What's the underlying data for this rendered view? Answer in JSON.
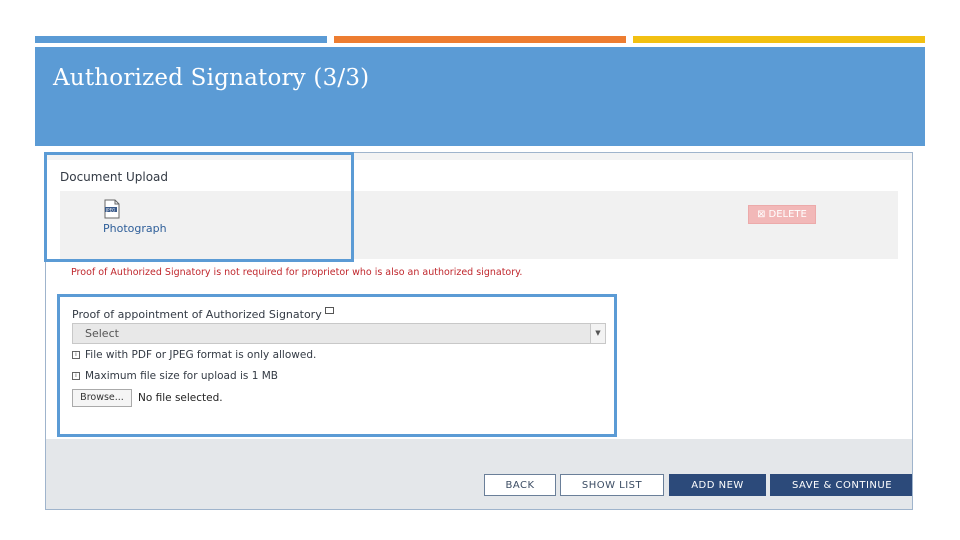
{
  "slide": {
    "title": "Authorized Signatory (3/3)",
    "accent_colors": [
      "#5b9bd5",
      "#ed7d31",
      "#f2c012"
    ]
  },
  "document_upload": {
    "heading": "Document Upload",
    "file_icon_label": "JPEG",
    "photo_link": "Photograph",
    "delete_label": "DELETE"
  },
  "notice": "Proof of Authorized Signatory is not required for proprietor who is also an authorized signatory.",
  "proof": {
    "label": "Proof of appointment of Authorized Signatory",
    "select_value": "Select",
    "format_note": "File with PDF or JPEG format is only allowed.",
    "size_note": "Maximum file size for upload is 1 MB",
    "browse_label": "Browse...",
    "file_status": "No file selected."
  },
  "actions": {
    "back": "BACK",
    "show_list": "SHOW LIST",
    "add_new": "ADD NEW",
    "save_continue": "SAVE & CONTINUE"
  },
  "colors": {
    "primary": "#2c4a7a",
    "highlight": "#5b9bd5",
    "error": "#c0272d"
  }
}
